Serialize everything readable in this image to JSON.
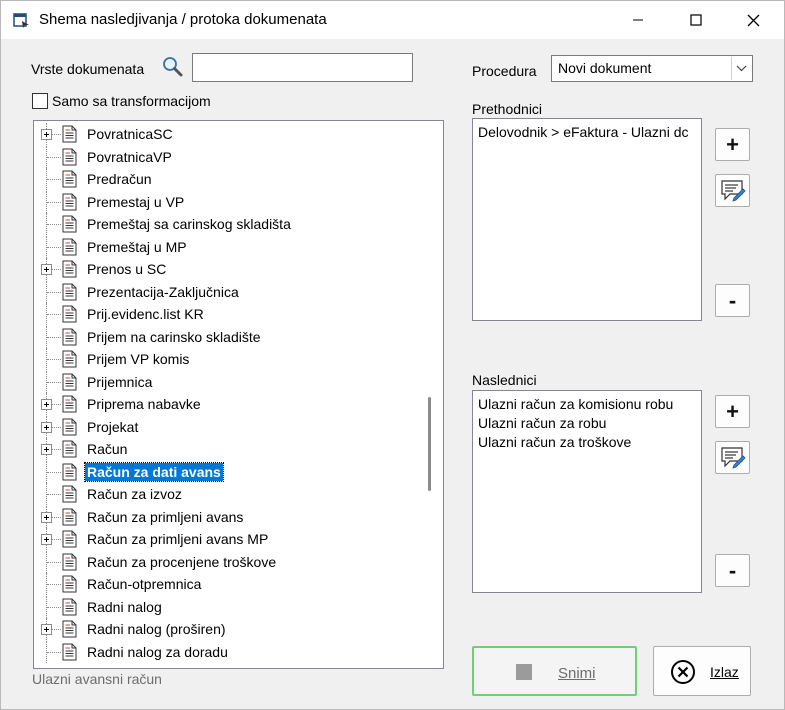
{
  "window": {
    "title": "Shema nasledjivanja / protoka dokumenata"
  },
  "left": {
    "doc_types_label": "Vrste dokumenata",
    "search_value": "",
    "transform_checkbox_label": "Samo sa transformacijom",
    "transform_checked": false,
    "tree_items": [
      {
        "label": "PovratnicaSC",
        "expandable": true,
        "selected": false
      },
      {
        "label": "PovratnicaVP",
        "expandable": false,
        "selected": false
      },
      {
        "label": "Predračun",
        "expandable": false,
        "selected": false
      },
      {
        "label": "Premestaj u VP",
        "expandable": false,
        "selected": false
      },
      {
        "label": "Premeštaj sa carinskog skladišta",
        "expandable": false,
        "selected": false
      },
      {
        "label": "Premeštaj u MP",
        "expandable": false,
        "selected": false
      },
      {
        "label": "Prenos u SC",
        "expandable": true,
        "selected": false
      },
      {
        "label": "Prezentacija-Zaključnica",
        "expandable": false,
        "selected": false
      },
      {
        "label": "Prij.evidenc.list KR",
        "expandable": false,
        "selected": false
      },
      {
        "label": "Prijem na carinsko skladište",
        "expandable": false,
        "selected": false
      },
      {
        "label": "Prijem VP komis",
        "expandable": false,
        "selected": false
      },
      {
        "label": "Prijemnica",
        "expandable": false,
        "selected": false
      },
      {
        "label": "Priprema nabavke",
        "expandable": true,
        "selected": false
      },
      {
        "label": "Projekat",
        "expandable": true,
        "selected": false
      },
      {
        "label": "Račun",
        "expandable": true,
        "selected": false
      },
      {
        "label": "Račun za dati avans",
        "expandable": false,
        "selected": true
      },
      {
        "label": "Račun za izvoz",
        "expandable": false,
        "selected": false
      },
      {
        "label": "Račun za primljeni avans",
        "expandable": true,
        "selected": false
      },
      {
        "label": "Račun za primljeni avans MP",
        "expandable": true,
        "selected": false
      },
      {
        "label": "Račun za procenjene troškove",
        "expandable": false,
        "selected": false
      },
      {
        "label": "Račun-otpremnica",
        "expandable": false,
        "selected": false
      },
      {
        "label": "Radni nalog",
        "expandable": false,
        "selected": false
      },
      {
        "label": "Radni nalog (proširen)",
        "expandable": true,
        "selected": false
      },
      {
        "label": "Radni nalog za doradu",
        "expandable": false,
        "selected": false
      }
    ],
    "status_text": "Ulazni avansni račun"
  },
  "right": {
    "procedure_label": "Procedura",
    "procedure_value": "Novi dokument",
    "predecessors_label": "Prethodnici",
    "predecessors": [
      "Delovodnik > eFaktura - Ulazni dc"
    ],
    "successors_label": "Naslednici",
    "successors": [
      "Ulazni račun za komisionu robu",
      "Ulazni račun za robu",
      "Ulazni račun za troškove"
    ],
    "add_symbol": "+",
    "remove_symbol": "-"
  },
  "footer": {
    "save_label": "Snimi",
    "exit_label": "Izlaz"
  }
}
